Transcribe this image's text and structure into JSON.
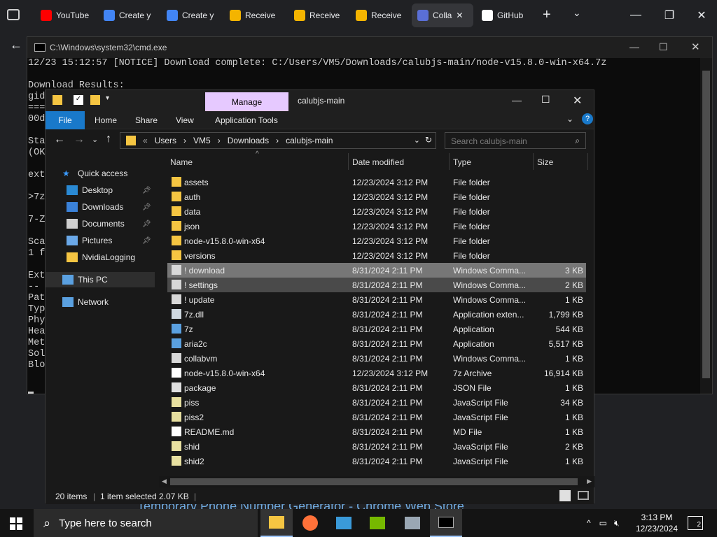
{
  "browser": {
    "tabs": [
      {
        "label": "YouTube",
        "fav": "#ff0000",
        "icon": "youtube-icon"
      },
      {
        "label": "Create y",
        "fav": "#4285f4",
        "icon": "google-icon"
      },
      {
        "label": "Create y",
        "fav": "#4285f4",
        "icon": "google-icon"
      },
      {
        "label": "Receive",
        "fav": "#f4b400",
        "icon": "receive-icon"
      },
      {
        "label": "Receive",
        "fav": "#f4b400",
        "icon": "receive-icon"
      },
      {
        "label": "Receive",
        "fav": "#f4b400",
        "icon": "receive-icon"
      },
      {
        "label": "Colla",
        "fav": "#5a6fd6",
        "icon": "collab-icon"
      },
      {
        "label": "GitHub",
        "fav": "#ffffff",
        "icon": "github-icon"
      }
    ],
    "new_tab": "+",
    "underlying_text": "Temporary Phone Number Generator - Chrome Web Store"
  },
  "cmd": {
    "title": "C:\\Windows\\system32\\cmd.exe",
    "lines": [
      "12/23 15:12:57 [NOTICE] Download complete: C:/Users/VM5/Downloads/calubjs-main/node-v15.8.0-win-x64.7z",
      "",
      "Download Results:",
      "gid",
      "===",
      "00d",
      "",
      "Sta",
      "(OK",
      "",
      "ext",
      "",
      ">7z",
      "",
      "7-Z",
      "",
      "Sca",
      "1 f",
      "",
      "Ext",
      "--",
      "Pat",
      "Typ",
      "Phy",
      "Hea",
      "Met",
      "Sol",
      "Blo"
    ]
  },
  "explorer": {
    "title": "calubjs-main",
    "manage": "Manage",
    "ribbon": [
      "File",
      "Home",
      "Share",
      "View",
      "Application Tools"
    ],
    "breadcrumb": [
      "Users",
      "VM5",
      "Downloads",
      "calubjs-main"
    ],
    "search_placeholder": "Search calubjs-main",
    "nav": [
      {
        "label": "Quick access",
        "icon": "star-icon",
        "color": "#3b9cff"
      },
      {
        "label": "Desktop",
        "icon": "desktop-icon",
        "color": "#2a8ad4",
        "pin": true
      },
      {
        "label": "Downloads",
        "icon": "download-arrow-icon",
        "color": "#3b82d9",
        "pin": true
      },
      {
        "label": "Documents",
        "icon": "document-icon",
        "color": "#cfcfcf",
        "pin": true
      },
      {
        "label": "Pictures",
        "icon": "pictures-icon",
        "color": "#6aa8e8",
        "pin": true
      },
      {
        "label": "NvidiaLogging",
        "icon": "folder-icon",
        "color": "#f5c542"
      },
      {
        "label": "This PC",
        "icon": "computer-icon",
        "color": "#5aa0e0"
      },
      {
        "label": "Network",
        "icon": "network-icon",
        "color": "#5aa0e0"
      }
    ],
    "columns": [
      "Name",
      "Date modified",
      "Type",
      "Size"
    ],
    "files": [
      {
        "name": "assets",
        "date": "12/23/2024 3:12 PM",
        "type": "File folder",
        "size": "",
        "icon": "folder-icon"
      },
      {
        "name": "auth",
        "date": "12/23/2024 3:12 PM",
        "type": "File folder",
        "size": "",
        "icon": "folder-icon"
      },
      {
        "name": "data",
        "date": "12/23/2024 3:12 PM",
        "type": "File folder",
        "size": "",
        "icon": "folder-icon"
      },
      {
        "name": "json",
        "date": "12/23/2024 3:12 PM",
        "type": "File folder",
        "size": "",
        "icon": "folder-icon"
      },
      {
        "name": "node-v15.8.0-win-x64",
        "date": "12/23/2024 3:12 PM",
        "type": "File folder",
        "size": "",
        "icon": "folder-icon"
      },
      {
        "name": "versions",
        "date": "12/23/2024 3:12 PM",
        "type": "File folder",
        "size": "",
        "icon": "folder-icon"
      },
      {
        "name": "! download",
        "date": "8/31/2024 2:11 PM",
        "type": "Windows Comma...",
        "size": "3 KB",
        "icon": "batch-file-icon"
      },
      {
        "name": "! settings",
        "date": "8/31/2024 2:11 PM",
        "type": "Windows Comma...",
        "size": "2 KB",
        "icon": "batch-file-icon"
      },
      {
        "name": "! update",
        "date": "8/31/2024 2:11 PM",
        "type": "Windows Comma...",
        "size": "1 KB",
        "icon": "batch-file-icon"
      },
      {
        "name": "7z.dll",
        "date": "8/31/2024 2:11 PM",
        "type": "Application exten...",
        "size": "1,799 KB",
        "icon": "dll-icon"
      },
      {
        "name": "7z",
        "date": "8/31/2024 2:11 PM",
        "type": "Application",
        "size": "544 KB",
        "icon": "application-icon"
      },
      {
        "name": "aria2c",
        "date": "8/31/2024 2:11 PM",
        "type": "Application",
        "size": "5,517 KB",
        "icon": "application-icon"
      },
      {
        "name": "collabvm",
        "date": "8/31/2024 2:11 PM",
        "type": "Windows Comma...",
        "size": "1 KB",
        "icon": "batch-file-icon"
      },
      {
        "name": "node-v15.8.0-win-x64",
        "date": "12/23/2024 3:12 PM",
        "type": "7z Archive",
        "size": "16,914 KB",
        "icon": "archive-icon"
      },
      {
        "name": "package",
        "date": "8/31/2024 2:11 PM",
        "type": "JSON File",
        "size": "1 KB",
        "icon": "json-file-icon"
      },
      {
        "name": "piss",
        "date": "8/31/2024 2:11 PM",
        "type": "JavaScript File",
        "size": "34 KB",
        "icon": "js-file-icon"
      },
      {
        "name": "piss2",
        "date": "8/31/2024 2:11 PM",
        "type": "JavaScript File",
        "size": "1 KB",
        "icon": "js-file-icon"
      },
      {
        "name": "README.md",
        "date": "8/31/2024 2:11 PM",
        "type": "MD File",
        "size": "1 KB",
        "icon": "md-file-icon"
      },
      {
        "name": "shid",
        "date": "8/31/2024 2:11 PM",
        "type": "JavaScript File",
        "size": "2 KB",
        "icon": "js-file-icon"
      },
      {
        "name": "shid2",
        "date": "8/31/2024 2:11 PM",
        "type": "JavaScript File",
        "size": "1 KB",
        "icon": "js-file-icon"
      }
    ],
    "selected_index": 6,
    "hover_index": 7,
    "status_items": "20 items",
    "status_selected": "1 item selected  2.07 KB"
  },
  "taskbar": {
    "search_placeholder": "Type here to search",
    "time": "3:13 PM",
    "date": "12/23/2024",
    "notifications": "2"
  }
}
